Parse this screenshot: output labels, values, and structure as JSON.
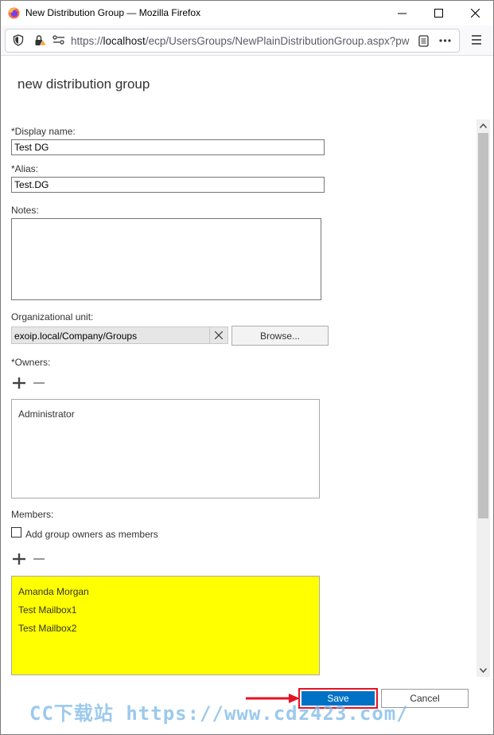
{
  "window": {
    "title": "New Distribution Group — Mozilla Firefox",
    "url_prefix": "https://",
    "url_host": "localhost",
    "url_rest": "/ecp/UsersGroups/NewPlainDistributionGroup.aspx?pw"
  },
  "page": {
    "title": "new distribution group"
  },
  "form": {
    "display_name_label": "*Display name:",
    "display_name_value": "Test DG",
    "alias_label": "*Alias:",
    "alias_value": "Test.DG",
    "notes_label": "Notes:",
    "notes_value": "",
    "ou_label": "Organizational unit:",
    "ou_value": "exoip.local/Company/Groups",
    "browse_label": "Browse...",
    "owners_label": "*Owners:",
    "owners": [
      "Administrator"
    ],
    "members_label": "Members:",
    "add_owners_label": "Add group owners as members",
    "members": [
      "Amanda Morgan",
      "Test Mailbox1",
      "Test Mailbox2"
    ],
    "members_highlight_color": "#ffff00"
  },
  "footer": {
    "save_label": "Save",
    "cancel_label": "Cancel",
    "save_color": "#0072c6",
    "highlight_border_color": "#e81123"
  },
  "watermark": "CC下载站 https://www.cdz423.com/"
}
